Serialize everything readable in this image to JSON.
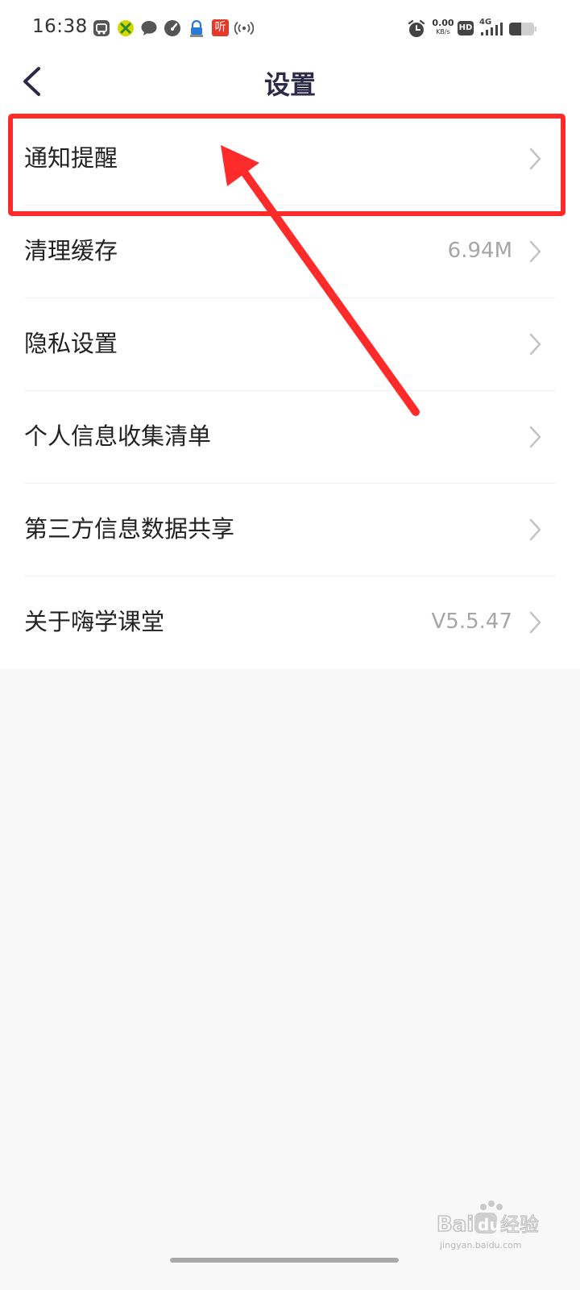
{
  "status_bar": {
    "time": "16:38",
    "net_speed_value": "0.00",
    "net_speed_unit": "KB/s",
    "hd_badge": "HD",
    "network_type": "4G",
    "listen_app_label": "听",
    "left_icons": [
      "app-box-icon",
      "lemon-app-icon",
      "chat-bubble-icon",
      "speedometer-icon",
      "lock-app-icon",
      "listen-app-icon",
      "hotspot-icon"
    ],
    "right_icons": [
      "alarm-icon",
      "hd-icon",
      "signal-icon",
      "battery-icon"
    ]
  },
  "header": {
    "title": "设置",
    "back_icon": "chevron-left-icon"
  },
  "settings": {
    "items": [
      {
        "label": "通知提醒",
        "value": ""
      },
      {
        "label": "清理缓存",
        "value": "6.94M"
      },
      {
        "label": "隐私设置",
        "value": ""
      },
      {
        "label": "个人信息收集清单",
        "value": ""
      },
      {
        "label": "第三方信息数据共享",
        "value": ""
      },
      {
        "label": "关于嗨学课堂",
        "value": "V5.5.47"
      }
    ]
  },
  "annotation": {
    "color": "#ff2a2a"
  },
  "watermark": {
    "logo_text": "Bai经验",
    "url": "jingyan.baidu.com"
  },
  "colors": {
    "background": "#f8f8f8",
    "title": "#2c2a48",
    "label": "#222222",
    "value": "#a6a6a6"
  }
}
